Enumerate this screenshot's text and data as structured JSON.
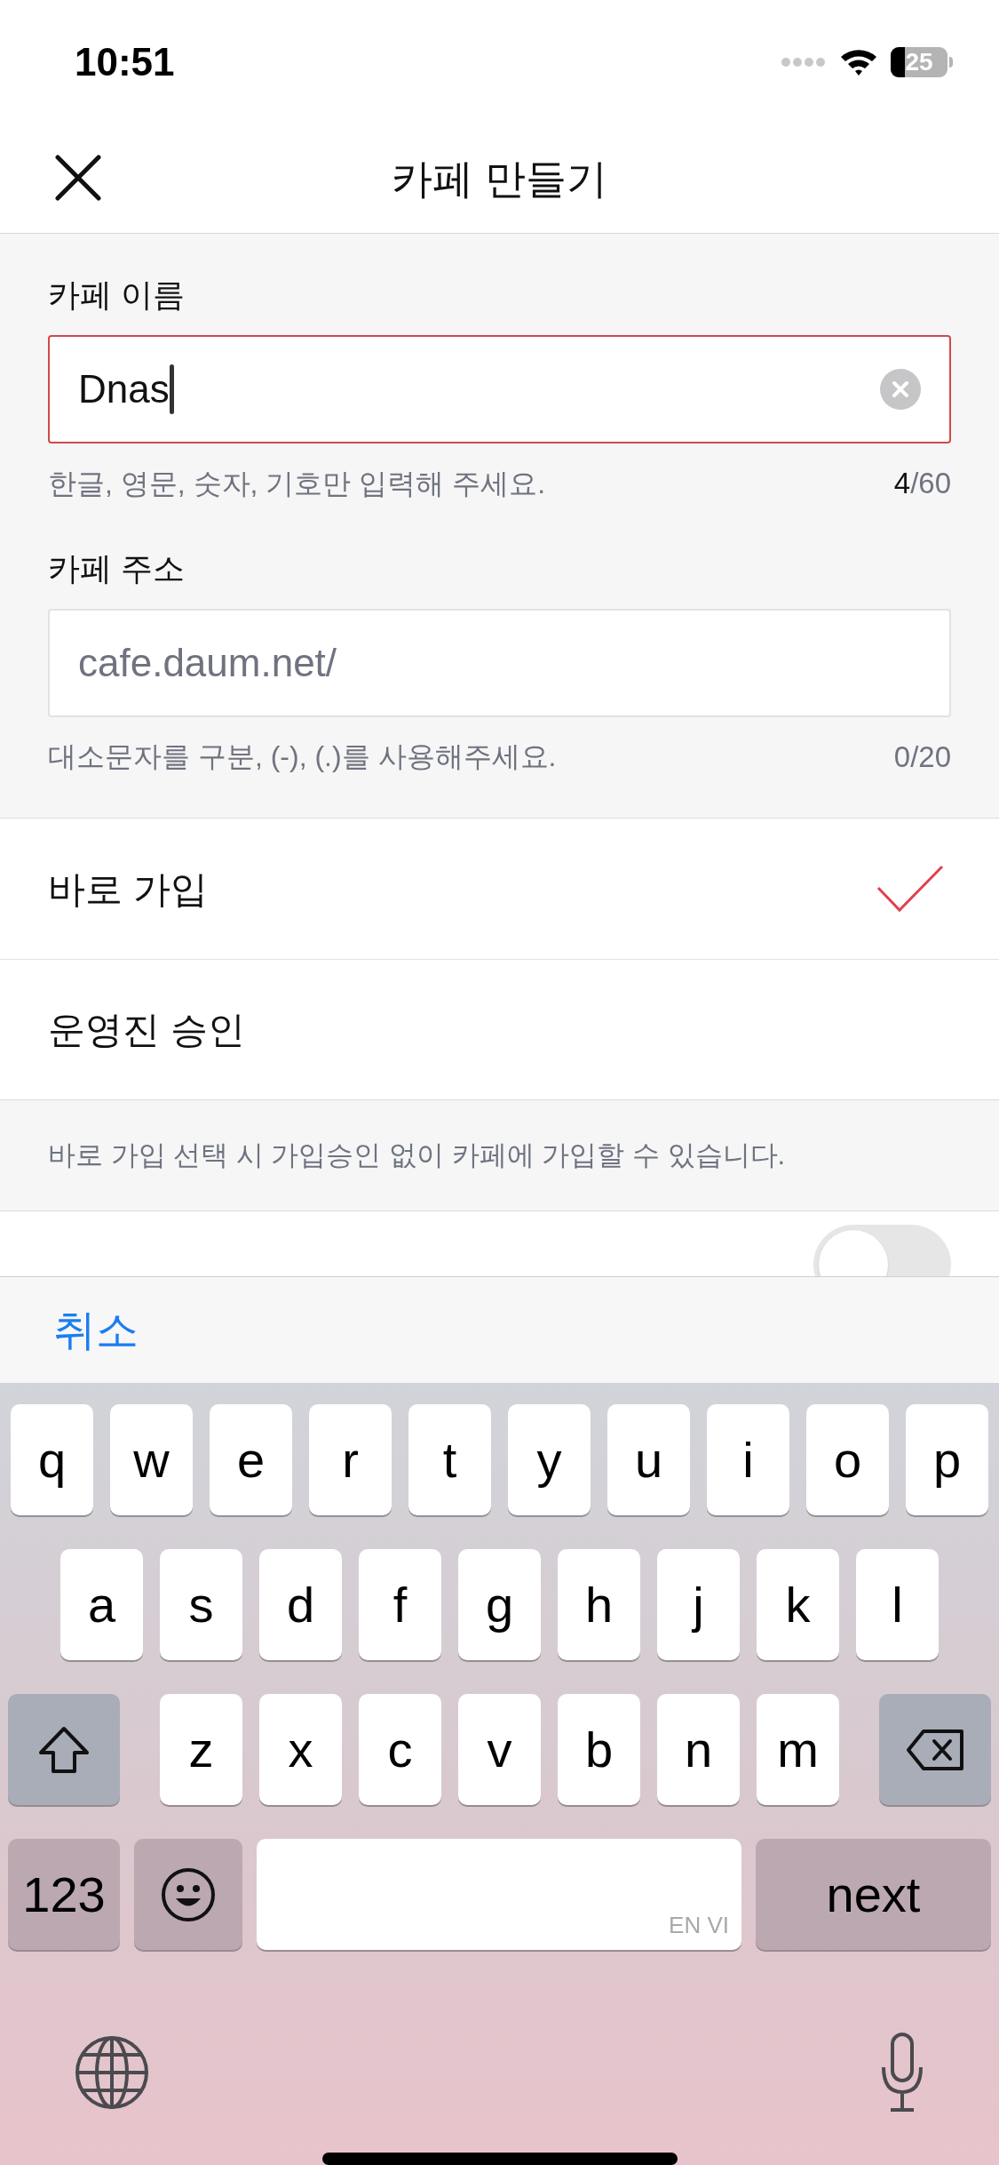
{
  "status_bar": {
    "time": "10:51",
    "battery": "25"
  },
  "nav": {
    "title": "카페 만들기"
  },
  "fields": [
    {
      "label": "카페 이름",
      "value": "Dnas",
      "focused": true,
      "hint": "한글, 영문, 숫자, 기호만 입력해 주세요.",
      "count": "4",
      "total": "/60"
    },
    {
      "label": "카페 주소",
      "placeholder": "cafe.daum.net/",
      "focused": false,
      "hint": "대소문자를 구분, (-), (.)를 사용해주세요.",
      "count": "0",
      "total": "/20"
    }
  ],
  "join_options": [
    {
      "label": "바로 가입",
      "selected": true
    },
    {
      "label": "운영진 승인",
      "selected": false
    }
  ],
  "note": "바로 가입 선택 시 가입승인 없이 카페에 가입할 수 있습니다.",
  "privacy_row": {
    "on": false
  },
  "accessory": {
    "cancel": "취소"
  },
  "keyboard": {
    "rows": [
      [
        "q",
        "w",
        "e",
        "r",
        "t",
        "y",
        "u",
        "i",
        "o",
        "p"
      ],
      [
        "a",
        "s",
        "d",
        "f",
        "g",
        "h",
        "j",
        "k",
        "l"
      ],
      [
        "z",
        "x",
        "c",
        "v",
        "b",
        "n",
        "m"
      ]
    ],
    "numbers": "123",
    "space": "EN VI",
    "return": "next"
  }
}
